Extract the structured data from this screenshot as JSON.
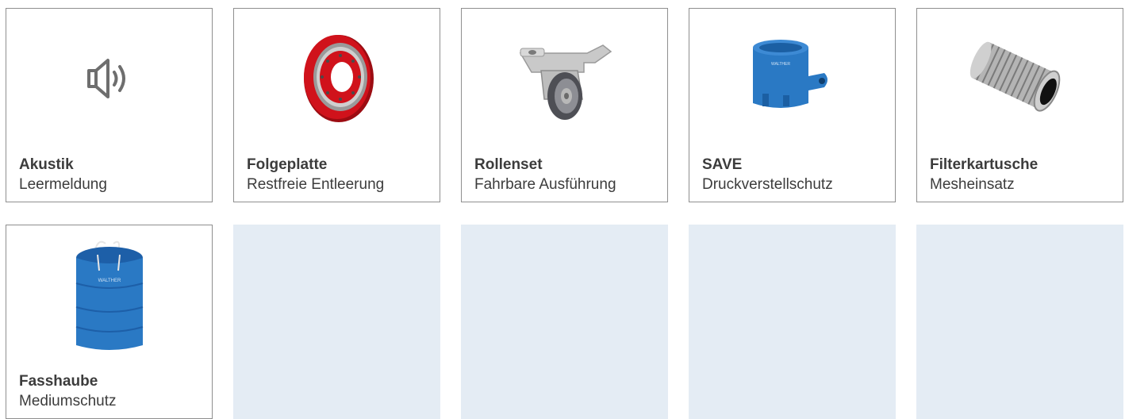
{
  "products": [
    {
      "title": "Akustik",
      "subtitle": "Leermeldung",
      "icon": "speaker-icon"
    },
    {
      "title": "Folgeplatte",
      "subtitle": "Restfreie Entleerung",
      "icon": "follower-plate-icon"
    },
    {
      "title": "Rollenset",
      "subtitle": "Fahrbare Ausführung",
      "icon": "caster-wheel-icon"
    },
    {
      "title": "SAVE",
      "subtitle": "Druckverstellschutz",
      "icon": "save-sleeve-icon"
    },
    {
      "title": "Filterkartusche",
      "subtitle": "Mesheinsatz",
      "icon": "filter-cartridge-icon"
    },
    {
      "title": "Fasshaube",
      "subtitle": "Mediumschutz",
      "icon": "drum-cover-icon"
    }
  ],
  "colors": {
    "border": "#8f8f8f",
    "placeholder": "#e4ecf4",
    "text": "#3c3c3c",
    "red": "#d0121b",
    "blue": "#2a79c4"
  }
}
